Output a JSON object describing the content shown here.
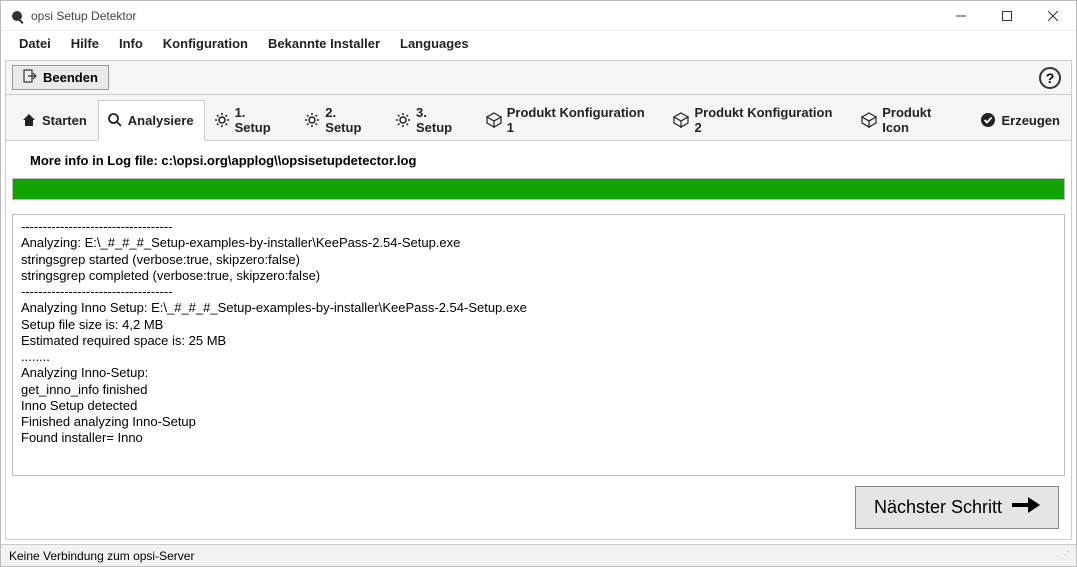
{
  "window": {
    "title": "opsi Setup Detektor"
  },
  "menu": {
    "items": [
      "Datei",
      "Hilfe",
      "Info",
      "Konfiguration",
      "Bekannte Installer",
      "Languages"
    ]
  },
  "toolbar": {
    "exit_label": "Beenden",
    "help_symbol": "?"
  },
  "tabs": [
    {
      "id": "start",
      "label": "Starten",
      "icon": "home-icon",
      "active": false
    },
    {
      "id": "analyze",
      "label": "Analysiere",
      "icon": "search-icon",
      "active": true
    },
    {
      "id": "setup1",
      "label": "1. Setup",
      "icon": "gear-icon",
      "active": false
    },
    {
      "id": "setup2",
      "label": "2. Setup",
      "icon": "gear-icon",
      "active": false
    },
    {
      "id": "setup3",
      "label": "3. Setup",
      "icon": "gear-icon",
      "active": false
    },
    {
      "id": "pconf1",
      "label": "Produkt Konfiguration 1",
      "icon": "cube-icon",
      "active": false
    },
    {
      "id": "pconf2",
      "label": "Produkt Konfiguration 2",
      "icon": "cube-icon",
      "active": false
    },
    {
      "id": "picon",
      "label": "Produkt Icon",
      "icon": "cube-icon",
      "active": false
    },
    {
      "id": "make",
      "label": "Erzeugen",
      "icon": "check-icon",
      "active": false
    }
  ],
  "analyze": {
    "info_line": "More info in Log file: c:\\opsi.org\\applog\\\\opsisetupdetector.log",
    "progress_percent": 100,
    "log_text": "-----------------------------------\nAnalyzing: E:\\_#_#_#_Setup-examples-by-installer\\KeePass-2.54-Setup.exe\nstringsgrep started (verbose:true, skipzero:false)\nstringsgrep completed (verbose:true, skipzero:false)\n-----------------------------------\nAnalyzing Inno Setup: E:\\_#_#_#_Setup-examples-by-installer\\KeePass-2.54-Setup.exe\nSetup file size is: 4,2 MB\nEstimated required space is: 25 MB\n........\nAnalyzing Inno-Setup:\nget_inno_info finished\nInno Setup detected\nFinished analyzing Inno-Setup\nFound installer= Inno",
    "next_label": "Nächster Schritt"
  },
  "status": {
    "text": "Keine Verbindung zum opsi-Server"
  },
  "colors": {
    "progress": "#11a400"
  }
}
